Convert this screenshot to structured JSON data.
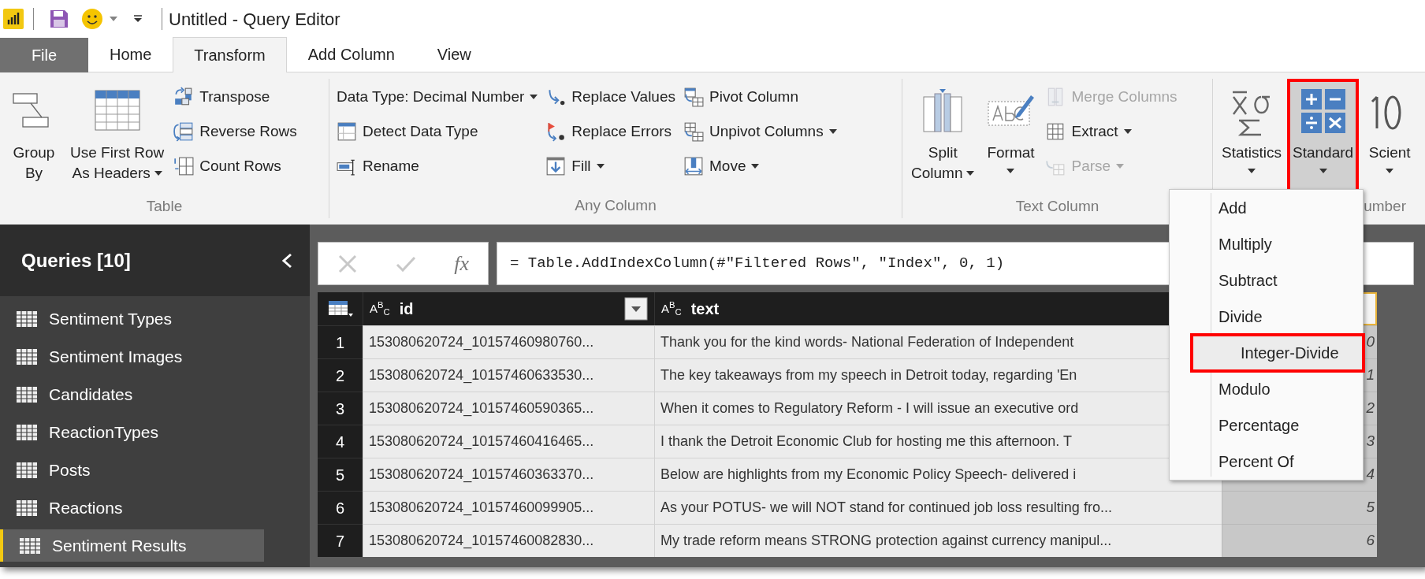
{
  "title_bar": {
    "title": "Untitled - Query Editor"
  },
  "file_tab": "File",
  "tabs": [
    {
      "label": "Home",
      "selected": false
    },
    {
      "label": "Transform",
      "selected": true
    },
    {
      "label": "Add Column",
      "selected": false
    },
    {
      "label": "View",
      "selected": false
    }
  ],
  "ribbon_groups": [
    {
      "label": "Table",
      "columns": [
        {
          "kind": "large",
          "lines": [
            "Group",
            "By"
          ],
          "dropdown": false,
          "pressed": false,
          "highlighted": false
        },
        {
          "kind": "large",
          "lines": [
            "Use First Row",
            "As Headers"
          ],
          "dropdown": true,
          "pressed": false,
          "highlighted": false
        },
        {
          "kind": "stack",
          "items": [
            {
              "label": "Transpose",
              "dropdown": false,
              "disabled": false
            },
            {
              "label": "Reverse Rows",
              "dropdown": false,
              "disabled": false
            },
            {
              "label": "Count Rows",
              "dropdown": false,
              "disabled": false
            }
          ]
        }
      ]
    },
    {
      "label": "Any Column",
      "columns": [
        {
          "kind": "stack",
          "items": [
            {
              "label": "Data Type: Decimal Number",
              "dropdown": true,
              "disabled": false
            },
            {
              "label": "Detect Data Type",
              "dropdown": false,
              "disabled": false
            },
            {
              "label": "Rename",
              "dropdown": false,
              "disabled": false
            }
          ]
        },
        {
          "kind": "stack",
          "items": [
            {
              "label": "Replace Values",
              "dropdown": false,
              "disabled": false
            },
            {
              "label": "Replace Errors",
              "dropdown": false,
              "disabled": false
            },
            {
              "label": "Fill",
              "dropdown": true,
              "disabled": false
            }
          ]
        },
        {
          "kind": "stack",
          "items": [
            {
              "label": "Pivot Column",
              "dropdown": false,
              "disabled": false
            },
            {
              "label": "Unpivot Columns",
              "dropdown": true,
              "disabled": false
            },
            {
              "label": "Move",
              "dropdown": true,
              "disabled": false
            }
          ]
        }
      ]
    },
    {
      "label": "Text Column",
      "columns": [
        {
          "kind": "large",
          "lines": [
            "Split",
            "Column"
          ],
          "dropdown": true,
          "pressed": false,
          "highlighted": false
        },
        {
          "kind": "large",
          "lines": [
            "Format"
          ],
          "dropdown": true,
          "pressed": false,
          "highlighted": false
        },
        {
          "kind": "stack",
          "items": [
            {
              "label": "Merge Columns",
              "dropdown": false,
              "disabled": true
            },
            {
              "label": "Extract",
              "dropdown": true,
              "disabled": false
            },
            {
              "label": "Parse",
              "dropdown": true,
              "disabled": true
            }
          ]
        }
      ]
    },
    {
      "label": "umber",
      "columns": [
        {
          "kind": "large",
          "lines": [
            "Statistics"
          ],
          "dropdown": true,
          "pressed": false,
          "highlighted": false
        },
        {
          "kind": "large",
          "lines": [
            "Standard"
          ],
          "dropdown": true,
          "pressed": true,
          "highlighted": true
        },
        {
          "kind": "large",
          "lines": [
            "Scient"
          ],
          "dropdown": true,
          "pressed": false,
          "highlighted": false
        }
      ]
    }
  ],
  "queries": {
    "title": "Queries [10]",
    "items": [
      {
        "label": "Sentiment Types",
        "selected": false
      },
      {
        "label": "Sentiment Images",
        "selected": false
      },
      {
        "label": "Candidates",
        "selected": false
      },
      {
        "label": "ReactionTypes",
        "selected": false
      },
      {
        "label": "Posts",
        "selected": false
      },
      {
        "label": "Reactions",
        "selected": false
      },
      {
        "label": "Sentiment Results",
        "selected": true
      }
    ]
  },
  "formula_bar": {
    "fx": "fx",
    "formula": "= Table.AddIndexColumn(#\"Filtered Rows\", \"Index\", 0, 1)"
  },
  "table": {
    "columns": [
      {
        "type": "A$^{B}$$_{C}$",
        "name": "id",
        "filter": true
      },
      {
        "type": "A$^{B}$$_{C}$",
        "name": "text",
        "filter": false
      }
    ],
    "index_column": {
      "selected": true
    },
    "rows": [
      {
        "n": "1",
        "id": "153080620724_10157460980760...",
        "text": "Thank you for the kind words- National Federation of Independent",
        "index": "0"
      },
      {
        "n": "2",
        "id": "153080620724_10157460633530...",
        "text": "The key takeaways from my speech in Detroit today, regarding 'En",
        "index": "1"
      },
      {
        "n": "3",
        "id": "153080620724_10157460590365...",
        "text": "When it comes to Regulatory Reform - I will issue an executive ord",
        "index": "2"
      },
      {
        "n": "4",
        "id": "153080620724_10157460416465...",
        "text": "I thank the Detroit Economic Club for hosting me this afternoon. T",
        "index": "3"
      },
      {
        "n": "5",
        "id": "153080620724_10157460363370...",
        "text": "Below are highlights from my Economic Policy Speech- delivered i",
        "index": "4"
      },
      {
        "n": "6",
        "id": "153080620724_10157460099905...",
        "text": "As your POTUS- we will NOT stand for continued job loss resulting fro...",
        "index": "5"
      },
      {
        "n": "7",
        "id": "153080620724_10157460082830...",
        "text": "My trade reform means STRONG protection against currency manipul...",
        "index": "6"
      }
    ]
  },
  "menu": {
    "items": [
      {
        "label": "Add",
        "highlighted": false
      },
      {
        "label": "Multiply",
        "highlighted": false
      },
      {
        "label": "Subtract",
        "highlighted": false
      },
      {
        "label": "Divide",
        "highlighted": false
      },
      {
        "label": "Integer-Divide",
        "highlighted": true
      },
      {
        "label": "Modulo",
        "highlighted": false
      },
      {
        "label": "Percentage",
        "highlighted": false
      },
      {
        "label": "Percent Of",
        "highlighted": false
      }
    ]
  }
}
